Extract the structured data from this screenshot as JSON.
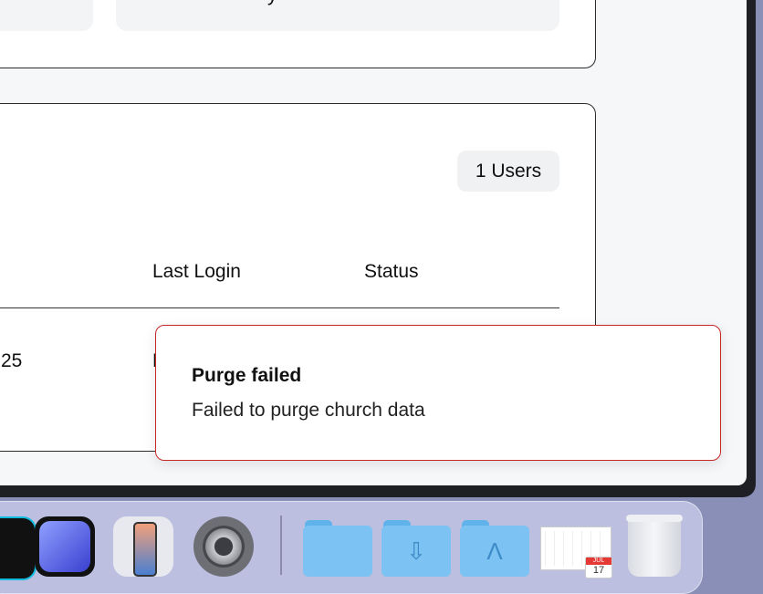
{
  "top_card": {
    "partial_text": "y"
  },
  "users_card": {
    "count_badge": "1 Users",
    "columns": [
      "Last Login",
      "Status"
    ],
    "row": {
      "date_fragment": "25",
      "last_login_fragment": "N"
    }
  },
  "toast": {
    "title": "Purge failed",
    "message": "Failed to purge church data"
  },
  "dock": {
    "apps": [
      "app-icon",
      "preview-icon",
      "iphone-mirroring-icon",
      "system-settings-icon",
      "folder-icon",
      "downloads-folder-icon",
      "applications-folder-icon",
      "calendar-icon",
      "trash-icon"
    ],
    "calendar_month": "JUL",
    "calendar_day": "17"
  },
  "colors": {
    "toast_border": "#c62828",
    "window_bg": "#f6f7f9"
  }
}
